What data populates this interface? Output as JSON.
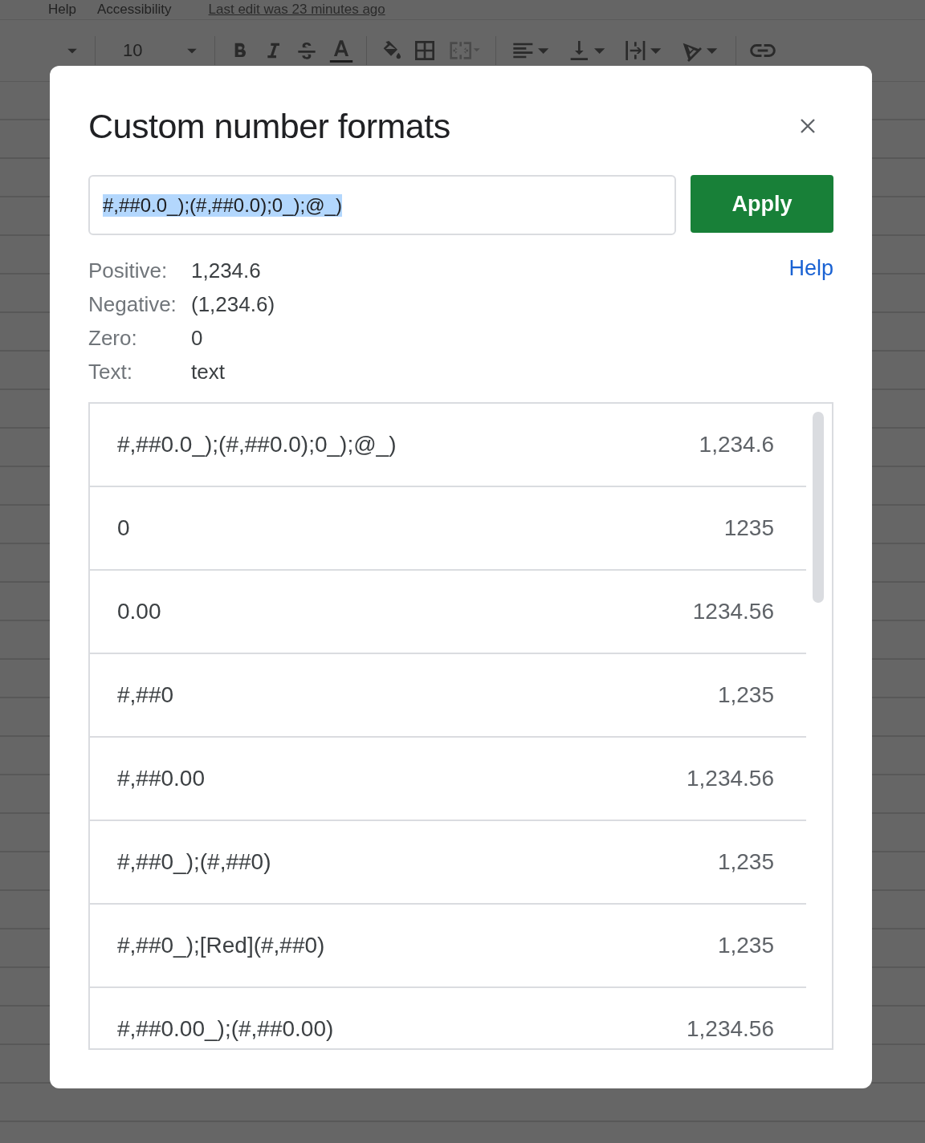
{
  "menu_bar": {
    "items": [
      "Help",
      "Accessibility"
    ],
    "last_edit": "Last edit was 23 minutes ago"
  },
  "toolbar": {
    "font_size": "10",
    "merge_disabled": true
  },
  "dialog": {
    "title": "Custom number formats",
    "format_input": {
      "value": "#,##0.0_);(#,##0.0);0_);@_)",
      "selected": true
    },
    "apply_button": "Apply",
    "help_link": "Help",
    "preview": [
      {
        "label": "Positive:",
        "value": "1,234.6"
      },
      {
        "label": "Negative:",
        "value": "(1,234.6)"
      },
      {
        "label": "Zero:",
        "value": "0"
      },
      {
        "label": "Text:",
        "value": "text"
      }
    ],
    "formats": [
      {
        "pattern": "#,##0.0_);(#,##0.0);0_);@_)",
        "sample": "1,234.6"
      },
      {
        "pattern": "0",
        "sample": "1235"
      },
      {
        "pattern": "0.00",
        "sample": "1234.56"
      },
      {
        "pattern": "#,##0",
        "sample": "1,235"
      },
      {
        "pattern": "#,##0.00",
        "sample": "1,234.56"
      },
      {
        "pattern": "#,##0_);(#,##0)",
        "sample": "1,235"
      },
      {
        "pattern": "#,##0_);[Red](#,##0)",
        "sample": "1,235"
      },
      {
        "pattern": "#,##0.00_);(#,##0.00)",
        "sample": "1,234.56"
      }
    ]
  }
}
